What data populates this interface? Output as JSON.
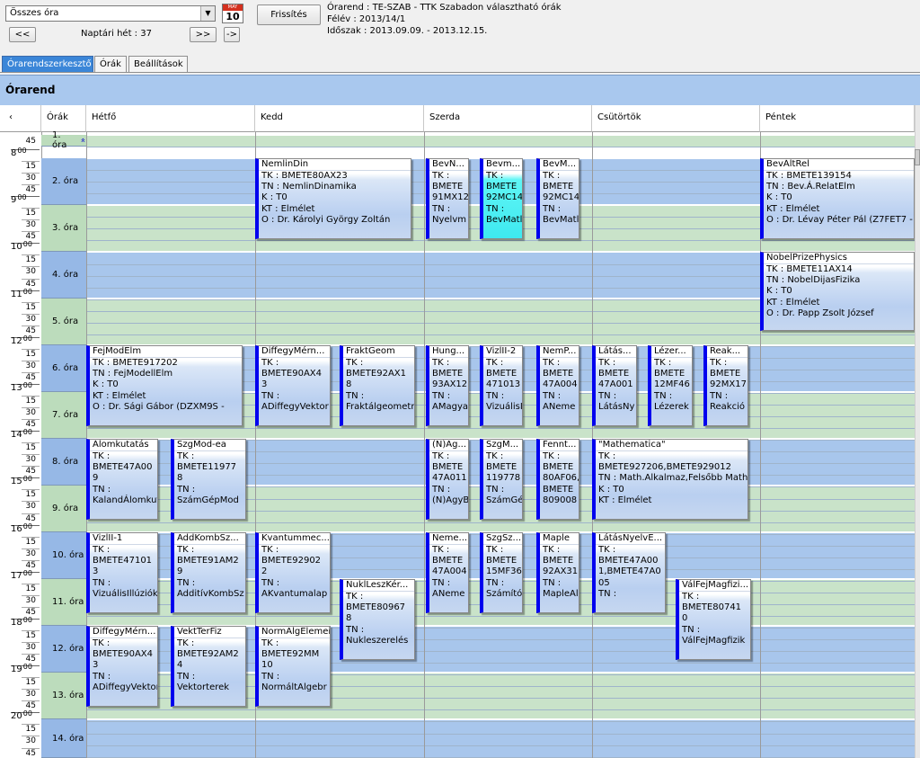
{
  "toolbar": {
    "combo_value": "Összes óra",
    "week_label": "Naptári hét : 37",
    "prev_label": "<<",
    "next_label": ">>",
    "jump_label": "->",
    "refresh_label": "Frissítés",
    "calendar_month": "MAY",
    "calendar_day": "10"
  },
  "info": {
    "line1": "Órarend : TE-SZAB - TTK Szabadon választható órák",
    "line2": "Félév : 2013/14/1",
    "line3": "Időszak : 2013.09.09. - 2013.12.15."
  },
  "tabs": [
    "Órarendszerkesztő",
    "Órák",
    "Beállítások"
  ],
  "section_title": "Órarend",
  "grid": {
    "corner_arrow": "‹",
    "col_hours": "Órák",
    "days": [
      "Hétfő",
      "Kedd",
      "Szerda",
      "Csütörtök",
      "Péntek"
    ],
    "hours": [
      "8",
      "9",
      "10",
      "11",
      "12",
      "13",
      "14",
      "15",
      "16",
      "17",
      "18",
      "19",
      "20"
    ],
    "hour_minute": "00",
    "minutes": [
      "15",
      "30",
      "45"
    ],
    "top_minute": "45",
    "rows": [
      "1. óra",
      "2. óra",
      "3. óra",
      "4. óra",
      "5. óra",
      "6. óra",
      "7. óra",
      "8. óra",
      "9. óra",
      "10. óra",
      "11. óra",
      "12. óra",
      "13. óra",
      "14. óra"
    ],
    "first_row_label": "1. óra"
  },
  "events": [
    {
      "title": "NemlinDin",
      "body": "TK : BMETE80AX23\nTN : NemlinDinamika\nK : T0\nKT : Elmélet\nO : Dr. Károlyi György Zoltán"
    },
    {
      "title": "BevN...",
      "body": "TK :\nBMETE\n91MX12\nTN :\nNyelvm"
    },
    {
      "title": "Bevm...",
      "body": "TK :\nBMETE\n92MC14\nTN :\nBevMatl"
    },
    {
      "title": "BevM...",
      "body": "TK :\nBMETE\n92MC14\nTN :\nBevMatl"
    },
    {
      "title": "BevÁltRel",
      "body": "TK : BMETE139154\nTN : Bev.Á.RelatElm\nK : T0\nKT : Elmélet\nO : Dr. Lévay Péter Pál (Z7FET7 -"
    },
    {
      "title": "NobelPrizePhysics",
      "body": "TK : BMETE11AX14\nTN : NobelDijasFizika\nK : T0\nKT : Elmélet\nO : Dr. Papp Zsolt József"
    },
    {
      "title": "FejModElm",
      "body": "TK : BMETE917202\nTN : FejModellElm\nK : T0\nKT : Elmélet\nO : Dr. Sági Gábor (DZXM9S -"
    },
    {
      "title": "DiffegyMérn...",
      "body": "TK :\nBMETE90AX4\n3\nTN :\nADiffegyVektor"
    },
    {
      "title": "FraktGeom",
      "body": "TK :\nBMETE92AX1\n8\nTN :\nFraktálgeometr"
    },
    {
      "title": "Hung...",
      "body": "TK :\nBMETE\n93AX12\nTN :\nAMagya"
    },
    {
      "title": "VizlII-2",
      "body": "TK :\nBMETE\n471013\nTN :\nVizuálisIl"
    },
    {
      "title": "NemP...",
      "body": "TK :\nBMETE\n47A004\nTN :\nANeme"
    },
    {
      "title": "Látás...",
      "body": "TK :\nBMETE\n47A001\nTN :\nLátásNy"
    },
    {
      "title": "Lézer...",
      "body": "TK :\nBMETE\n12MF46\nTN :\nLézerek"
    },
    {
      "title": "Reak...",
      "body": "TK :\nBMETE\n92MX17\nTN :\nReakció"
    },
    {
      "title": "Álomkutatás",
      "body": "TK :\nBMETE47A00\n9\nTN :\nKalandÁlomkut"
    },
    {
      "title": "SzgMod-ea",
      "body": "TK :\nBMETE11977\n8\nTN :\nSzámGépMod"
    },
    {
      "title": "(N)Ag...",
      "body": "TK :\nBMETE\n47A011\nTN :\n(N)AgyB"
    },
    {
      "title": "SzgM...",
      "body": "TK :\nBMETE\n119778\nTN :\nSzámGé"
    },
    {
      "title": "Fennt...",
      "body": "TK :\nBMETE\n80AF06,\nBMETE\n809008"
    },
    {
      "title": "\"Mathematica\"",
      "body": "TK :\nBMETE927206,BMETE929012\nTN : Math.Alkalmaz,Felsőbb Math.\nK : T0\nKT : Elmélet"
    },
    {
      "title": "VizlII-1",
      "body": "TK :\nBMETE47101\n3\nTN :\nVizuálisIllúziók"
    },
    {
      "title": "AddKombSz...",
      "body": "TK :\nBMETE91AM2\n9\nTN :\nAdditívKombSz"
    },
    {
      "title": "Kvantummec...",
      "body": "TK :\nBMETE92902\n2\nTN :\nAKvantumalap"
    },
    {
      "title": "Neme...",
      "body": "TK :\nBMETE\n47A004\nTN :\nANeme"
    },
    {
      "title": "SzgSz...",
      "body": "TK :\nBMETE\n15MF36\nTN :\nSzámító"
    },
    {
      "title": "Maple",
      "body": "TK :\nBMETE\n92AX31\nTN :\nMapleAl"
    },
    {
      "title": "LátásNyelvE...",
      "body": "TK :\nBMETE47A00\n1,BMETE47A0\n05\nTN :"
    },
    {
      "title": "NuklLeszKér...",
      "body": "TK :\nBMETE80967\n8\nTN :\nNukleszerelés"
    },
    {
      "title": "VálFejMagfizi...",
      "body": "TK :\nBMETE80741\n0\nTN :\nVálFejMagfizik"
    },
    {
      "title": "DiffegyMérn...",
      "body": "TK :\nBMETE90AX4\n3\nTN :\nADiffegyVektor"
    },
    {
      "title": "VektTerFiz",
      "body": "TK :\nBMETE92AM2\n4\nTN :\nVektorterek"
    },
    {
      "title": "NormAlgElemei",
      "body": "TK :\nBMETE92MM\n10\nTN :\nNormáltAlgebr"
    }
  ]
}
